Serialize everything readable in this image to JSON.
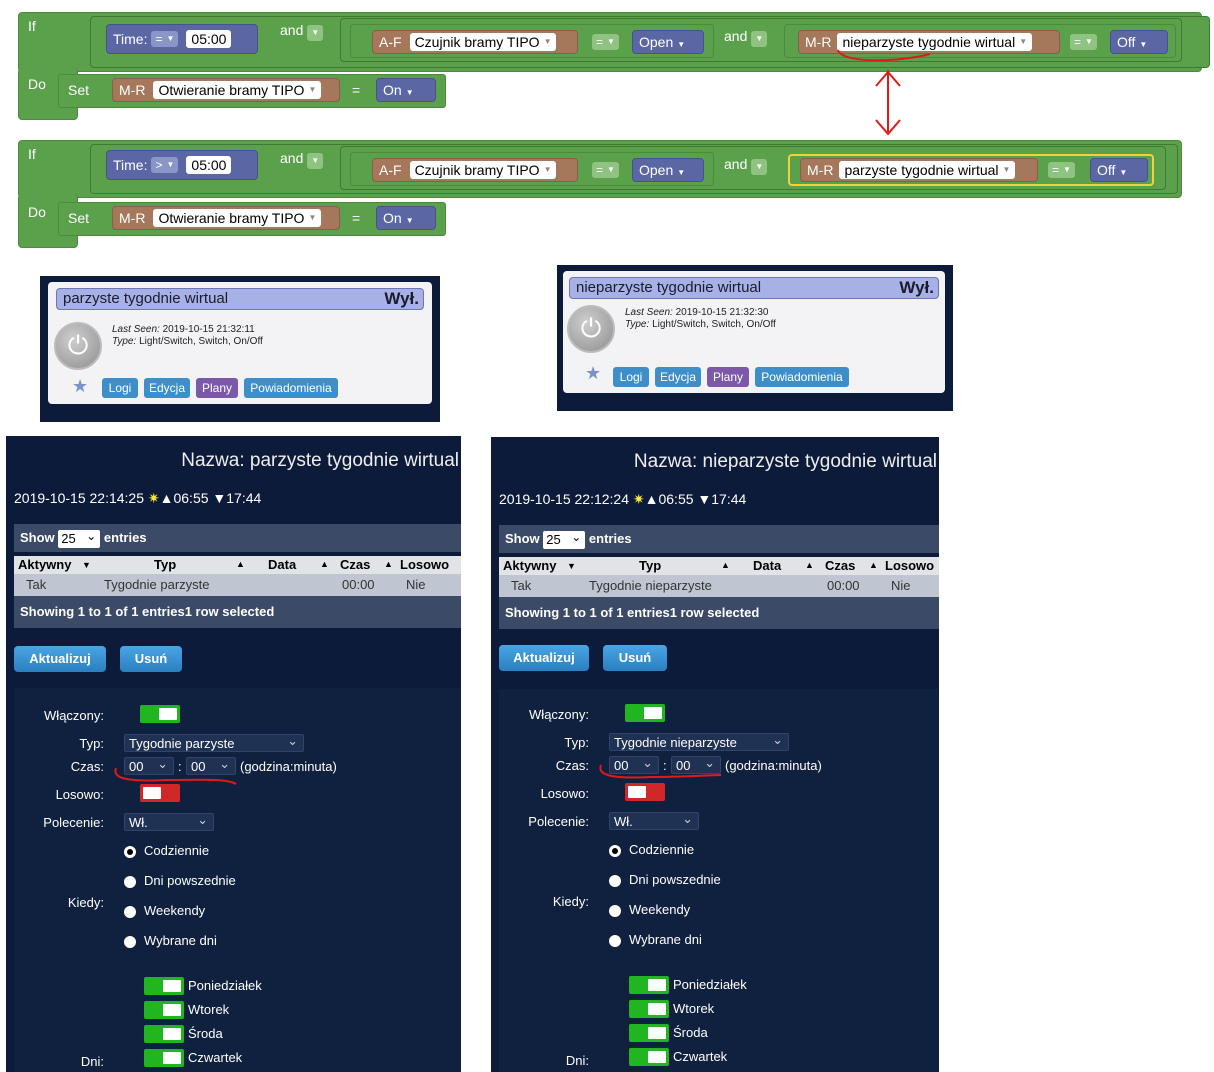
{
  "rule1": {
    "if_kw": "If",
    "do_kw": "Do",
    "set_kw": "Set",
    "time_label": "Time:",
    "time_op": "=",
    "time_value": "05:00",
    "and1": "and",
    "sensor_prefix": "A-F",
    "sensor_name": "Czujnik bramy TIPO",
    "sensor_op": "=",
    "sensor_state": "Open",
    "and2": "and",
    "switch_prefix": "M-R",
    "switch_name": "nieparzyste tygodnie wirtual",
    "switch_op": "=",
    "switch_state": "Off",
    "target_prefix": "M-R",
    "target_name": "Otwieranie bramy TIPO",
    "target_op": "=",
    "target_state": "On"
  },
  "rule2": {
    "if_kw": "If",
    "do_kw": "Do",
    "set_kw": "Set",
    "time_label": "Time:",
    "time_op": ">",
    "time_value": "05:00",
    "and1": "and",
    "sensor_prefix": "A-F",
    "sensor_name": "Czujnik bramy TIPO",
    "sensor_op": "=",
    "sensor_state": "Open",
    "and2": "and",
    "switch_prefix": "M-R",
    "switch_name": "parzyste tygodnie wirtual",
    "switch_op": "=",
    "switch_state": "Off",
    "target_prefix": "M-R",
    "target_name": "Otwieranie bramy TIPO",
    "target_op": "=",
    "target_state": "On"
  },
  "card1": {
    "title": "parzyste tygodnie wirtual",
    "state": "Wył.",
    "last_seen_label": "Last Seen:",
    "last_seen": "2019-10-15 21:32:11",
    "type_label": "Type:",
    "type": "Light/Switch, Switch, On/Off",
    "btn_logs": "Logi",
    "btn_edit": "Edycja",
    "btn_plans": "Plany",
    "btn_notify": "Powiadomienia"
  },
  "card2": {
    "title": "nieparzyste tygodnie wirtual",
    "state": "Wył.",
    "last_seen_label": "Last Seen:",
    "last_seen": "2019-10-15 21:32:30",
    "type_label": "Type:",
    "type": "Light/Switch, Switch, On/Off",
    "btn_logs": "Logi",
    "btn_edit": "Edycja",
    "btn_plans": "Plany",
    "btn_notify": "Powiadomienia"
  },
  "panel1": {
    "title": "Nazwa: parzyste tygodnie wirtual",
    "datetime": "2019-10-15 22:14:25",
    "sunrise": "▲06:55",
    "sunset": "▼17:44",
    "show": "Show",
    "entries_count": "25",
    "entries": "entries",
    "headers": [
      "Aktywny",
      "Typ",
      "Data",
      "Czas",
      "Losowo"
    ],
    "row": {
      "active": "Tak",
      "type": "Tygodnie parzyste",
      "date": "",
      "time": "00:00",
      "random": "Nie"
    },
    "showing": "Showing 1 to 1 of 1 entries1 row selected",
    "btn_update": "Aktualizuj",
    "btn_delete": "Usuń",
    "enabled_label": "Włączony:",
    "type_label": "Typ:",
    "type_value": "Tygodnie parzyste",
    "time_label": "Czas:",
    "hour": "00",
    "minute": "00",
    "time_hint": "(godzina:minuta)",
    "random_label": "Losowo:",
    "command_label": "Polecenie:",
    "command_value": "Wł.",
    "when_label": "Kiedy:",
    "when_options": [
      "Codziennie",
      "Dni powszednie",
      "Weekendy",
      "Wybrane dni"
    ],
    "days_label": "Dni:",
    "days": [
      "Poniedziałek",
      "Wtorek",
      "Środa",
      "Czwartek"
    ]
  },
  "panel2": {
    "title": "Nazwa: nieparzyste tygodnie wirtual",
    "datetime": "2019-10-15 22:12:24",
    "sunrise": "▲06:55",
    "sunset": "▼17:44",
    "show": "Show",
    "entries_count": "25",
    "entries": "entries",
    "headers": [
      "Aktywny",
      "Typ",
      "Data",
      "Czas",
      "Losowo"
    ],
    "row": {
      "active": "Tak",
      "type": "Tygodnie nieparzyste",
      "date": "",
      "time": "00:00",
      "random": "Nie"
    },
    "showing": "Showing 1 to 1 of 1 entries1 row selected",
    "btn_update": "Aktualizuj",
    "btn_delete": "Usuń",
    "enabled_label": "Włączony:",
    "type_label": "Typ:",
    "type_value": "Tygodnie nieparzyste",
    "time_label": "Czas:",
    "hour": "00",
    "minute": "00",
    "time_hint": "(godzina:minuta)",
    "random_label": "Losowo:",
    "command_label": "Polecenie:",
    "command_value": "Wł.",
    "when_label": "Kiedy:",
    "when_options": [
      "Codziennie",
      "Dni powszednie",
      "Weekendy",
      "Wybrane dni"
    ],
    "days_label": "Dni:",
    "days": [
      "Poniedziałek",
      "Wtorek",
      "Środa",
      "Czwartek"
    ]
  },
  "colors": {
    "annotation_red": "#e01a1a",
    "block_green": "#5ba14b",
    "block_blue": "#5b67a5",
    "block_brown": "#a5775b"
  }
}
